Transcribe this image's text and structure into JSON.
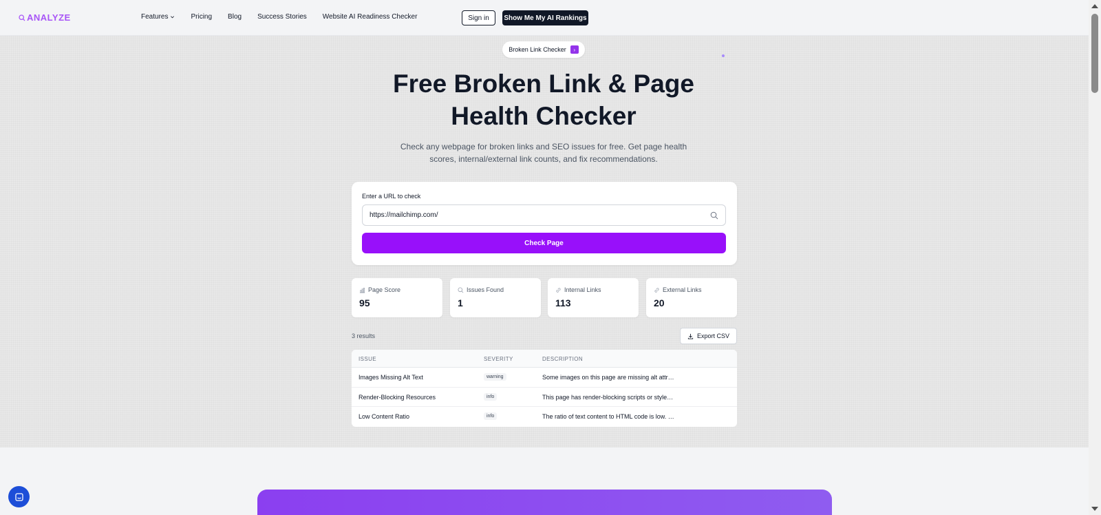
{
  "header": {
    "logo_text": "ANALYZE",
    "logo_icon": "search-icon",
    "nav": [
      {
        "label": "Features",
        "has_dropdown": true
      },
      {
        "label": "Pricing"
      },
      {
        "label": "Blog"
      },
      {
        "label": "Success Stories"
      },
      {
        "label": "Website AI Readiness Checker"
      }
    ],
    "sign_in_label": "Sign in",
    "cta_label": "Show Me My AI Rankings"
  },
  "hero": {
    "pill_label": "Broken Link Checker",
    "pill_arrow": "›",
    "title_line1": "Free Broken Link & Page",
    "title_line2": "Health Checker",
    "subtitle_line1": "Check any webpage for broken links and SEO issues for free. Get page health",
    "subtitle_line2": "scores, internal/external link counts, and fix recommendations."
  },
  "checker": {
    "label": "Enter a URL to check",
    "url_value": "https://mailchimp.com/",
    "button_label": "Check Page"
  },
  "stats": [
    {
      "label": "Page Score",
      "value": "95",
      "icon": "bar-chart-icon"
    },
    {
      "label": "Issues Found",
      "value": "1",
      "icon": "search-icon"
    },
    {
      "label": "Internal Links",
      "value": "113",
      "icon": "link-icon"
    },
    {
      "label": "External Links",
      "value": "20",
      "icon": "link-icon"
    }
  ],
  "results": {
    "count_text": "3 results",
    "export_label": "Export CSV",
    "columns": [
      "ISSUE",
      "SEVERITY",
      "DESCRIPTION"
    ],
    "rows": [
      {
        "issue": "Images Missing Alt Text",
        "severity": "warning",
        "description": "Some images on this page are missing alt attr…"
      },
      {
        "issue": "Render-Blocking Resources",
        "severity": "info",
        "description": "This page has render-blocking scripts or style…"
      },
      {
        "issue": "Low Content Ratio",
        "severity": "info",
        "description": "The ratio of text content to HTML code is low. …"
      }
    ]
  },
  "colors": {
    "brand_purple": "#9810fa",
    "logo_purple": "#a855f7",
    "dark": "#111827"
  }
}
